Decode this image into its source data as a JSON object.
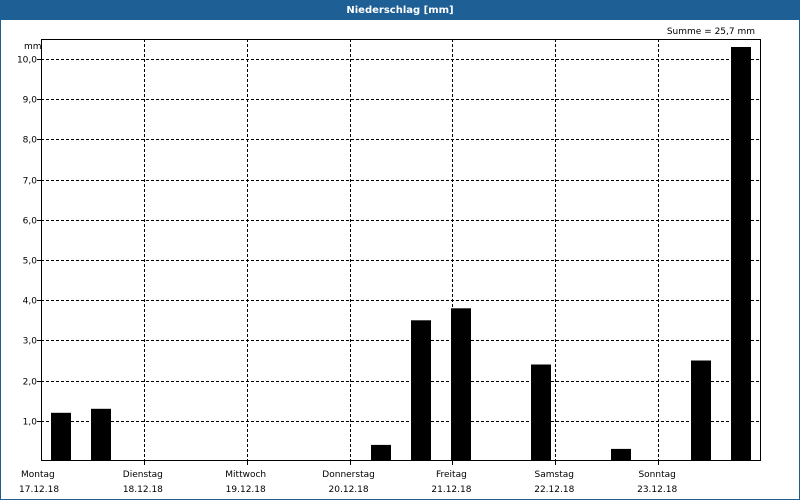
{
  "window": {
    "title": "Niederschlag [mm]"
  },
  "chart_data": {
    "type": "bar",
    "title": "Niederschlag [mm]",
    "ylabel": "mm",
    "annotation": "Summe = 25,7 mm",
    "ylim": [
      0,
      10.5
    ],
    "yticks": [
      "1,0",
      "2,0",
      "3,0",
      "4,0",
      "5,0",
      "6,0",
      "7,0",
      "8,0",
      "9,0",
      "10,0"
    ],
    "grid": true,
    "days": [
      {
        "name": "Montag",
        "date": "17.12.18"
      },
      {
        "name": "Dienstag",
        "date": "18.12.18"
      },
      {
        "name": "Mittwoch",
        "date": "19.12.18"
      },
      {
        "name": "Donnerstag",
        "date": "20.12.18"
      },
      {
        "name": "Freitag",
        "date": "21.12.18"
      },
      {
        "name": "Samstag",
        "date": "22.12.18"
      },
      {
        "name": "Sonntag",
        "date": "23.12.18"
      }
    ],
    "period_hours": 12,
    "values": [
      1.2,
      1.3,
      0,
      0,
      0,
      0,
      0,
      0,
      0.4,
      3.5,
      3.8,
      0,
      2.4,
      0,
      0.3,
      0,
      2.5,
      10.3
    ],
    "bar_color": "#000000"
  }
}
